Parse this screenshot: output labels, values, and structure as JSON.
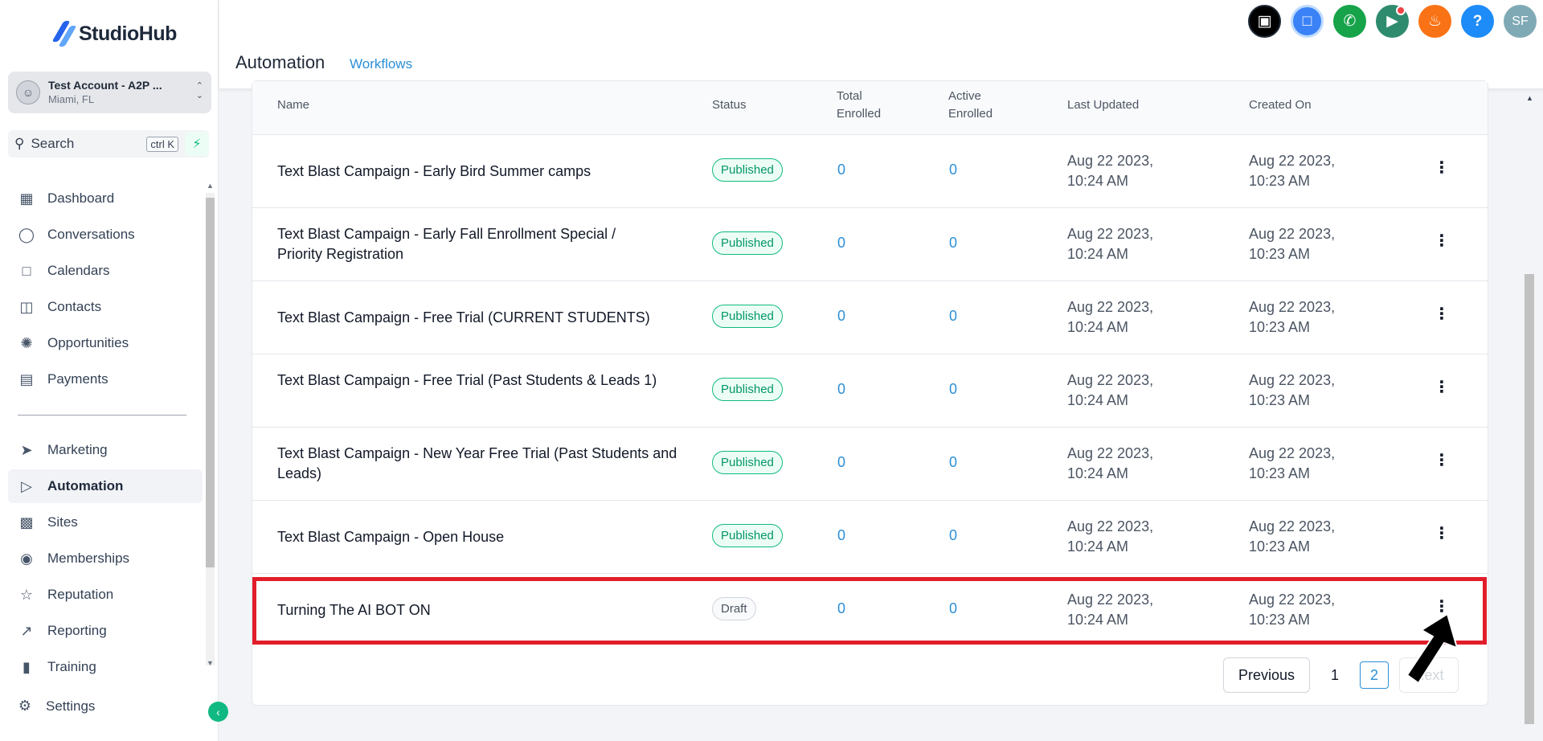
{
  "app": {
    "name": "StudioHub"
  },
  "account": {
    "name": "Test Account - A2P ...",
    "location": "Miami, FL"
  },
  "search": {
    "label": "Search",
    "shortcut": "ctrl K"
  },
  "nav": {
    "items": [
      {
        "label": "Dashboard",
        "icon": "dashboard-icon"
      },
      {
        "label": "Conversations",
        "icon": "chat-icon"
      },
      {
        "label": "Calendars",
        "icon": "calendar-icon"
      },
      {
        "label": "Contacts",
        "icon": "contacts-icon"
      },
      {
        "label": "Opportunities",
        "icon": "opportunities-icon"
      },
      {
        "label": "Payments",
        "icon": "payments-icon"
      },
      {
        "label": "Marketing",
        "icon": "send-icon"
      },
      {
        "label": "Automation",
        "icon": "automation-icon",
        "active": true
      },
      {
        "label": "Sites",
        "icon": "sites-icon"
      },
      {
        "label": "Memberships",
        "icon": "memberships-icon"
      },
      {
        "label": "Reputation",
        "icon": "star-icon"
      },
      {
        "label": "Reporting",
        "icon": "reporting-icon"
      },
      {
        "label": "Training",
        "icon": "book-icon"
      }
    ],
    "settings": "Settings"
  },
  "header": {
    "title": "Automation",
    "tab": "Workflows",
    "icons": [
      {
        "name": "bot-icon",
        "color": "#000000"
      },
      {
        "name": "chat-icon",
        "color": "#3b82f6"
      },
      {
        "name": "phone-icon",
        "color": "#16a34a"
      },
      {
        "name": "megaphone-icon",
        "color": "#2e8b6e"
      },
      {
        "name": "bell-icon",
        "color": "#f97316"
      },
      {
        "name": "help-icon",
        "color": "#1d8cf8"
      },
      {
        "name": "user-avatar",
        "color": "#7fa9b5",
        "text": "SF"
      }
    ]
  },
  "table": {
    "columns": {
      "name": "Name",
      "status": "Status",
      "total_enrolled": "Total Enrolled",
      "active_enrolled": "Active Enrolled",
      "last_updated": "Last Updated",
      "created_on": "Created On"
    },
    "rows": [
      {
        "name": "Text Blast Campaign - Early Bird Summer camps",
        "status": "Published",
        "total": "0",
        "active": "0",
        "updated_date": "Aug 22 2023,",
        "updated_time": "10:24 AM",
        "created_date": "Aug 22 2023,",
        "created_time": "10:23 AM"
      },
      {
        "name": "Text Blast Campaign - Early Fall Enrollment Special / Priority Registration",
        "status": "Published",
        "total": "0",
        "active": "0",
        "updated_date": "Aug 22 2023,",
        "updated_time": "10:24 AM",
        "created_date": "Aug 22 2023,",
        "created_time": "10:23 AM"
      },
      {
        "name": "Text Blast Campaign - Free Trial (CURRENT STUDENTS)",
        "status": "Published",
        "total": "0",
        "active": "0",
        "updated_date": "Aug 22 2023,",
        "updated_time": "10:24 AM",
        "created_date": "Aug 22 2023,",
        "created_time": "10:23 AM"
      },
      {
        "name": "Text Blast Campaign - Free Trial (Past Students & Leads 1)",
        "status": "Published",
        "total": "0",
        "active": "0",
        "updated_date": "Aug 22 2023,",
        "updated_time": "10:24 AM",
        "created_date": "Aug 22 2023,",
        "created_time": "10:23 AM"
      },
      {
        "name": "Text Blast Campaign - New Year Free Trial (Past Students and Leads)",
        "status": "Published",
        "total": "0",
        "active": "0",
        "updated_date": "Aug 22 2023,",
        "updated_time": "10:24 AM",
        "created_date": "Aug 22 2023,",
        "created_time": "10:23 AM"
      },
      {
        "name": "Text Blast Campaign - Open House",
        "status": "Published",
        "total": "0",
        "active": "0",
        "updated_date": "Aug 22 2023,",
        "updated_time": "10:24 AM",
        "created_date": "Aug 22 2023,",
        "created_time": "10:23 AM"
      },
      {
        "name": "Turning The AI BOT ON",
        "status": "Draft",
        "total": "0",
        "active": "0",
        "updated_date": "Aug 22 2023,",
        "updated_time": "10:24 AM",
        "created_date": "Aug 22 2023,",
        "created_time": "10:23 AM"
      }
    ]
  },
  "pagination": {
    "previous": "Previous",
    "pages": [
      "1",
      "2"
    ],
    "current": "2",
    "next": "Next"
  },
  "colors": {
    "accent": "#2b8fd6",
    "published": "#059669",
    "highlight": "#e11d2a"
  }
}
